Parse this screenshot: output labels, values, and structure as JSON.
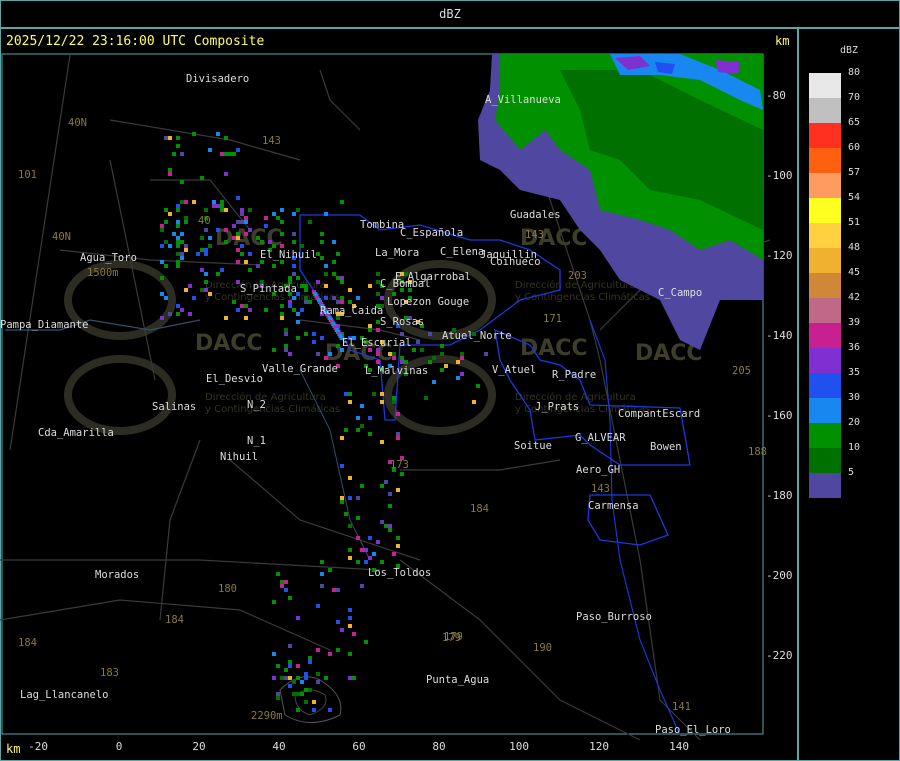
{
  "window": {
    "title": "dBZ"
  },
  "header": {
    "timestamp": "2025/12/22 23:16:00 UTC Composite",
    "unit_top": "km",
    "unit_bottom": "km"
  },
  "legend": {
    "title": "dBZ",
    "levels": [
      {
        "label": "80",
        "color": "#e8e8e8"
      },
      {
        "label": "70",
        "color": "#c0c0c0"
      },
      {
        "label": "65",
        "color": "#ff3020"
      },
      {
        "label": "60",
        "color": "#ff6010"
      },
      {
        "label": "57",
        "color": "#ff9a60"
      },
      {
        "label": "54",
        "color": "#ffff20"
      },
      {
        "label": "51",
        "color": "#ffd040"
      },
      {
        "label": "48",
        "color": "#f0b030"
      },
      {
        "label": "45",
        "color": "#d08838"
      },
      {
        "label": "42",
        "color": "#c06888"
      },
      {
        "label": "39",
        "color": "#c82090"
      },
      {
        "label": "36",
        "color": "#8030d0"
      },
      {
        "label": "35",
        "color": "#2050f0"
      },
      {
        "label": "30",
        "color": "#1888f0"
      },
      {
        "label": "20",
        "color": "#009000"
      },
      {
        "label": "10",
        "color": "#007000"
      },
      {
        "label": "5",
        "color": "#5048a0"
      }
    ]
  },
  "axes": {
    "x_ticks": [
      "-20",
      "0",
      "20",
      "40",
      "60",
      "80",
      "100",
      "120",
      "140"
    ],
    "y_ticks": [
      "-80",
      "-100",
      "-120",
      "-140",
      "-160",
      "-180",
      "-200",
      "-220"
    ]
  },
  "places": [
    {
      "name": "Divisadero"
    },
    {
      "name": "A_Villanueva"
    },
    {
      "name": "Guadales"
    },
    {
      "name": "Tombina"
    },
    {
      "name": "C_Española"
    },
    {
      "name": "C_Elena"
    },
    {
      "name": "Jaquillin"
    },
    {
      "name": "La_Mora"
    },
    {
      "name": "Agua_Toro"
    },
    {
      "name": "S_Pintada"
    },
    {
      "name": "C_Bombal"
    },
    {
      "name": "E_Algarrobal"
    },
    {
      "name": "Pampa_Diamante"
    },
    {
      "name": "Lopezon Gouge"
    },
    {
      "name": "S_Rosas"
    },
    {
      "name": "Atuel_Norte"
    },
    {
      "name": "El_Escurial"
    },
    {
      "name": "El_Desvio"
    },
    {
      "name": "Valle_Grande"
    },
    {
      "name": "L_Malvinas"
    },
    {
      "name": "V_Atuel"
    },
    {
      "name": "R_Padre"
    },
    {
      "name": "Salinas"
    },
    {
      "name": "J_Prats"
    },
    {
      "name": "CompantEscard"
    },
    {
      "name": "Cda_Amarilla"
    },
    {
      "name": "G_ALVEAR"
    },
    {
      "name": "Bowen"
    },
    {
      "name": "Soitue"
    },
    {
      "name": "Nihuil"
    },
    {
      "name": "Aero_GH"
    },
    {
      "name": "Carmensa"
    },
    {
      "name": "Morados"
    },
    {
      "name": "Los_Toldos"
    },
    {
      "name": "Paso_Burroso"
    },
    {
      "name": "Punta_Agua"
    },
    {
      "name": "Lag_Llancanelo"
    },
    {
      "name": "Paso_El_Loro"
    },
    {
      "name": "C_Campo"
    },
    {
      "name": "Rama_Caida"
    },
    {
      "name": "El_Nihuil"
    },
    {
      "name": "N_2"
    },
    {
      "name": "N_1"
    },
    {
      "name": "Coihueco"
    }
  ],
  "roads": [
    "143",
    "40N",
    "101",
    "40N",
    "173",
    "171",
    "203",
    "184",
    "180",
    "184",
    "179",
    "190",
    "183",
    "184",
    "143",
    "205",
    "188",
    "179",
    "141",
    "40",
    "143",
    "2290m",
    "1500m"
  ],
  "watermark": {
    "brand": "DACC",
    "subtitle": "Dirección de Agricultura",
    "subtitle2": "y Contingencias Climáticas"
  }
}
